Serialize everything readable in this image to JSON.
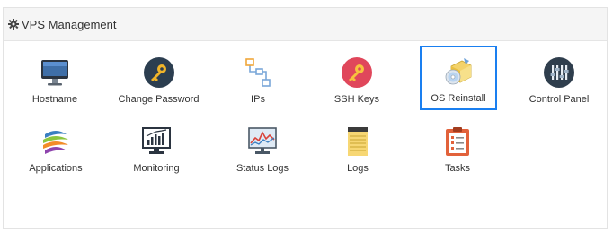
{
  "panel": {
    "title": "VPS Management",
    "header_icon": "gear-icon"
  },
  "accent_color": "#1a7ff0",
  "tiles": [
    {
      "label": "Hostname",
      "icon": "monitor-icon"
    },
    {
      "label": "Change Password",
      "icon": "key-icon"
    },
    {
      "label": "IPs",
      "icon": "network-icon"
    },
    {
      "label": "SSH Keys",
      "icon": "ssh-key-icon"
    },
    {
      "label": "OS Reinstall",
      "icon": "os-reinstall-icon",
      "selected": true
    },
    {
      "label": "Control Panel",
      "icon": "control-panel-icon"
    },
    {
      "label": "Applications",
      "icon": "applications-icon"
    },
    {
      "label": "Monitoring",
      "icon": "monitoring-icon"
    },
    {
      "label": "Status Logs",
      "icon": "status-logs-icon"
    },
    {
      "label": "Logs",
      "icon": "logs-icon"
    },
    {
      "label": "Tasks",
      "icon": "tasks-icon"
    }
  ]
}
